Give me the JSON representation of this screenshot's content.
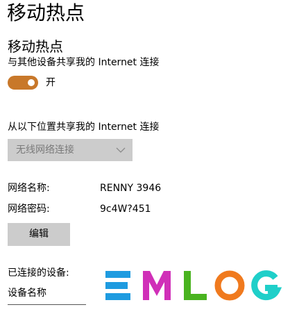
{
  "page": {
    "title": "移动热点"
  },
  "hotspot": {
    "section_title": "移动热点",
    "description": "与其他设备共享我的 Internet 连接",
    "toggle_state_label": "开",
    "toggle_on": true,
    "accent_color": "#c8782a"
  },
  "share_from": {
    "label": "从以下位置共享我的 Internet 连接",
    "selected": "无线网络连接",
    "disabled": true
  },
  "network": {
    "name_label": "网络名称:",
    "name_value": "RENNY 3946",
    "password_label": "网络密码:",
    "password_value": "9c4W?451",
    "edit_button": "编辑"
  },
  "devices": {
    "connected_label": "已连接的设备:",
    "column_header": "设备名称"
  },
  "watermark": {
    "text": "EMLOG",
    "letters": [
      {
        "char": "E",
        "color": "#1e9be0"
      },
      {
        "char": "M",
        "color": "#d02fb8"
      },
      {
        "char": "L",
        "color": "#49b31f"
      },
      {
        "char": "O",
        "color": "#f07a1e"
      },
      {
        "char": "G",
        "color": "#1fcfc9"
      }
    ]
  }
}
